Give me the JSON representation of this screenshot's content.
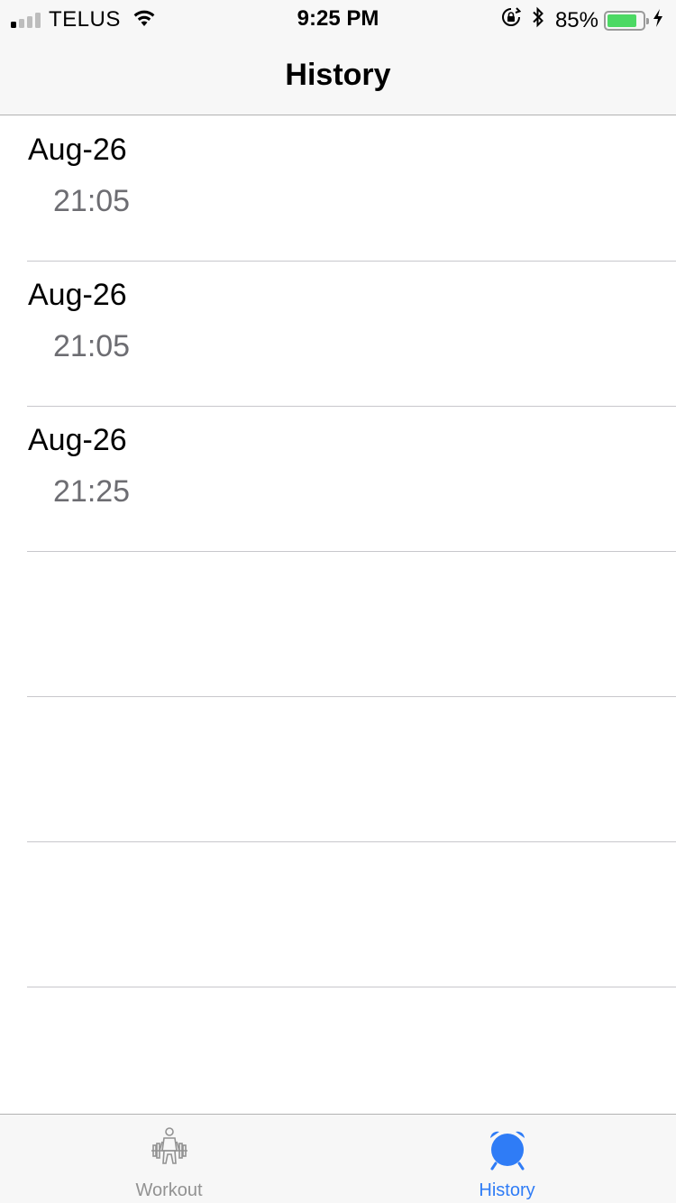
{
  "status_bar": {
    "carrier": "TELUS",
    "time": "9:25 PM",
    "battery_percent": "85%",
    "battery_level": 0.85,
    "icons": [
      "signal-icon",
      "wifi-icon",
      "rotation-lock-icon",
      "bluetooth-icon",
      "battery-icon",
      "charging-bolt-icon"
    ]
  },
  "nav": {
    "title": "History"
  },
  "history": {
    "rows": [
      {
        "date": "Aug-26",
        "time": "21:05"
      },
      {
        "date": "Aug-26",
        "time": "21:05"
      },
      {
        "date": "Aug-26",
        "time": "21:25"
      },
      {
        "date": "",
        "time": ""
      },
      {
        "date": "",
        "time": ""
      },
      {
        "date": "",
        "time": ""
      }
    ]
  },
  "tab_bar": {
    "tabs": [
      {
        "label": "Workout",
        "icon": "weightlifter-icon",
        "selected": false
      },
      {
        "label": "History",
        "icon": "alarm-clock-icon",
        "selected": true
      }
    ]
  },
  "colors": {
    "accent": "#2f7cf6",
    "inactive": "#929292",
    "secondary_text": "#6d6d72",
    "battery_green": "#4cd964"
  }
}
